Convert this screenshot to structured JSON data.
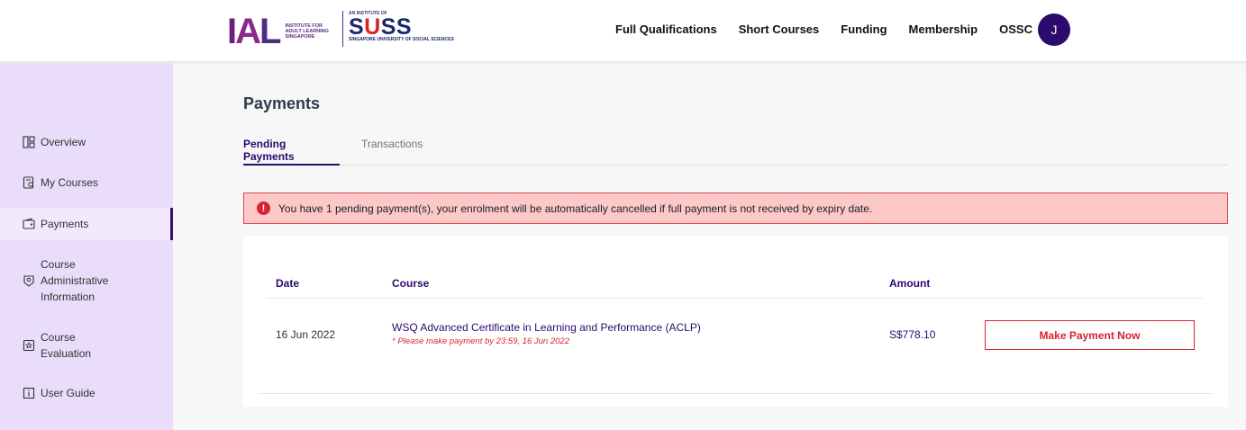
{
  "header": {
    "ial": {
      "letters_i": "I",
      "letters_a": "A",
      "letters_l": "L",
      "tagline": "Institute for Adult Learning Singapore"
    },
    "suss": {
      "small": "An Institute of",
      "name_s": "S",
      "name_u": "U",
      "name_ss": "SS",
      "sub": "Singapore University of Social Sciences"
    },
    "nav": [
      "Full Qualifications",
      "Short Courses",
      "Funding",
      "Membership",
      "OSSC"
    ],
    "avatar_initial": "J"
  },
  "sidebar": {
    "items": [
      {
        "label": "Overview",
        "icon": "layout-icon"
      },
      {
        "label": "My Courses",
        "icon": "courses-icon"
      },
      {
        "label": "Payments",
        "icon": "wallet-icon",
        "active": true
      },
      {
        "label": "Course Administrative Information",
        "icon": "badge-icon"
      },
      {
        "label": "Course Evaluation",
        "icon": "evaluation-icon"
      },
      {
        "label": "User Guide",
        "icon": "info-icon"
      }
    ],
    "colors": {
      "background": "#eadcfb",
      "active_background": "#f2eafc",
      "active_border": "#3a0d78"
    }
  },
  "main": {
    "title": "Payments",
    "tabs": [
      {
        "label": "Pending Payments",
        "active": true
      },
      {
        "label": "Transactions",
        "active": false
      }
    ],
    "alert": {
      "icon": "!",
      "text": "You have 1 pending payment(s), your enrolment will be automatically cancelled if full payment is not received by expiry date."
    },
    "table": {
      "headers": {
        "date": "Date",
        "course": "Course",
        "amount": "Amount"
      },
      "rows": [
        {
          "date": "16 Jun 2022",
          "course": "WSQ Advanced Certificate in Learning and Performance (ACLP)",
          "deadline": "* Please make payment by 23:59, 16 Jun 2022",
          "amount": "S$778.10",
          "action": "Make Payment Now"
        }
      ]
    }
  },
  "colors": {
    "brand_purple": "#2c0a6e",
    "alert_red": "#d9232e",
    "alert_bg": "#fcc8c8"
  }
}
